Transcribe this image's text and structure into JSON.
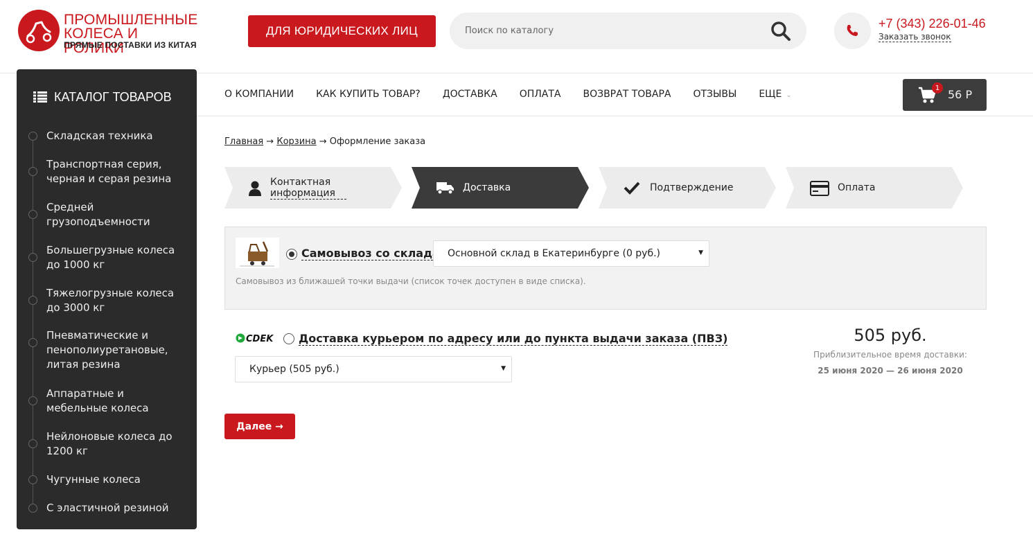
{
  "header": {
    "logo": {
      "line1": "ПРОМЫШЛЕННЫЕ",
      "line2": "КОЛЕСА И РОЛИКИ",
      "line3": "ПРЯМЫЕ ПОСТАВКИ ИЗ КИТАЯ"
    },
    "legal_button": "ДЛЯ ЮРИДИЧЕСКИХ ЛИЦ",
    "search": {
      "placeholder": "Поиск по каталогу",
      "icon": "search-icon"
    },
    "phone": {
      "number": "+7 (343) 226-01-46",
      "callback": "Заказать звонок",
      "icon": "phone-icon"
    }
  },
  "sidebar": {
    "title": "КАТАЛОГ ТОВАРОВ",
    "items": [
      {
        "label": "Складская техника"
      },
      {
        "label": "Транспортная серия, черная и серая резина"
      },
      {
        "label": "Средней грузоподъемности"
      },
      {
        "label": "Большегрузные колеса до 1000 кг"
      },
      {
        "label": "Тяжелогрузные колеса до 3000 кг"
      },
      {
        "label": "Пневматические и пенополиуретановые, литая резина"
      },
      {
        "label": "Аппаратные и мебельные колеса"
      },
      {
        "label": "Нейлоновые колеса до 1200 кг"
      },
      {
        "label": "Чугунные колеса"
      },
      {
        "label": "С эластичной резиной"
      }
    ]
  },
  "nav": {
    "items": [
      "О КОМПАНИИ",
      "КАК КУПИТЬ ТОВАР?",
      "ДОСТАВКА",
      "ОПЛАТА",
      "ВОЗВРАТ ТОВАРА",
      "ОТЗЫВЫ",
      "ЕЩЕ"
    ]
  },
  "cart": {
    "count": "1",
    "total": "56 Р"
  },
  "breadcrumb": {
    "home": "Главная",
    "cart": "Корзина",
    "current": "Оформление заказа",
    "separator": "→"
  },
  "steps": [
    {
      "label": "Контактная информация",
      "icon": "user-icon",
      "active": false
    },
    {
      "label": "Доставка",
      "icon": "truck-icon",
      "active": true
    },
    {
      "label": "Подтверждение",
      "icon": "checkmark-icon",
      "active": false
    },
    {
      "label": "Оплата",
      "icon": "credit-card-icon",
      "active": false
    }
  ],
  "pickup": {
    "title": "Самовывоз со склада",
    "selected": true,
    "warehouse": "Основной склад в Екатеринбурге (0 руб.)",
    "description": "Самовывоз из ближашей точки выдачи (список точек доступен в виде списка)."
  },
  "courier": {
    "logo_text": "CDEK",
    "title": "Доставка курьером по адресу или до пункта выдачи заказа (ПВЗ)",
    "selected": false,
    "option": "Курьер (505 руб.)",
    "price": "505 руб.",
    "eta_label": "Приблизительное время доставки:",
    "eta_dates": "25 июня 2020 — 26 июня 2020"
  },
  "next_button": "Далее →",
  "colors": {
    "brand": "#c9191e",
    "sidebar": "#2b2b2b",
    "cdek_green": "#1fa93b"
  }
}
